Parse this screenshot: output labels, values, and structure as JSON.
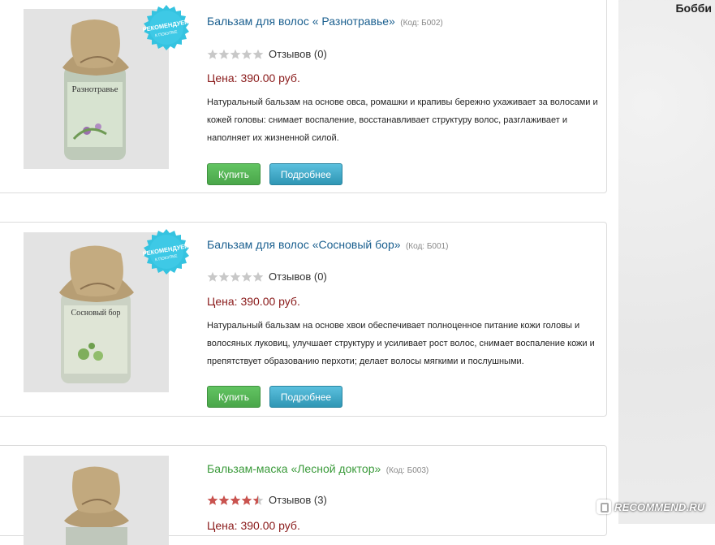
{
  "sidebar": {
    "user_name": "Бобби"
  },
  "watermark": {
    "text": "RECOMMEND.RU"
  },
  "badge": {
    "line1": "РЕКОМЕНДУЕМ",
    "line2": "К ПОКУПКЕ"
  },
  "products": [
    {
      "title": "Бальзам для волос « Разнотравье»",
      "code": "(Код: Б002)",
      "rating": 0,
      "reviews": "Отзывов (0)",
      "price": "Цена: 390.00 руб.",
      "description": "Натуральный бальзам на основе овса, ромашки и крапивы бережно ухаживает за волосами и кожей головы: снимает воспаление, восстанавливает структуру волос, разглаживает и наполняет их жизненной силой.",
      "label_on_bottle": "Разнотравье",
      "buy": "Купить",
      "more": "Подробнее",
      "recommended": true
    },
    {
      "title": "Бальзам для волос «Сосновый бор»",
      "code": "(Код: Б001)",
      "rating": 0,
      "reviews": "Отзывов (0)",
      "price": "Цена: 390.00 руб.",
      "description": "Натуральный бальзам на основе хвои обеспечивает полноценное питание кожи головы и волосяных луковиц, улучшает структуру и усиливает рост волос, снимает воспаление кожи и препятствует образованию перхоти; делает волосы мягкими и послушными.",
      "label_on_bottle": "Сосновый бор",
      "buy": "Купить",
      "more": "Подробнее",
      "recommended": true
    },
    {
      "title": "Бальзам-маска «Лесной доктор»",
      "code": "(Код: Б003)",
      "rating": 4.5,
      "reviews": "Отзывов (3)",
      "price": "Цена: 390.00 руб.",
      "recommended": false
    }
  ],
  "colors": {
    "title_link": "#1a5f8f",
    "title_link_green": "#3a9a3a",
    "price": "#8a1a1a",
    "buy_button": "#5cb85c",
    "more_button": "#5bc0de",
    "star_filled": "#c9534f",
    "star_empty": "#c8c8c8",
    "badge": "#35c3e0"
  }
}
